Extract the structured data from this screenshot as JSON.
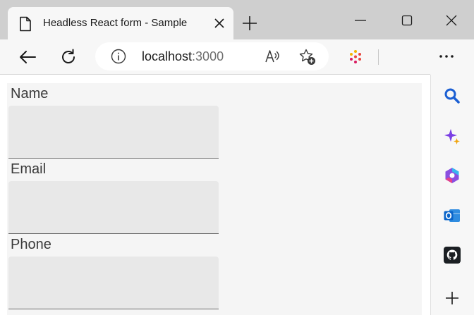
{
  "browser": {
    "tab": {
      "title": "Headless React form - Sample"
    },
    "address": {
      "host": "localhost",
      "port": ":3000"
    }
  },
  "form": {
    "fields": [
      {
        "label": "Name",
        "value": ""
      },
      {
        "label": "Email",
        "value": ""
      },
      {
        "label": "Phone",
        "value": ""
      }
    ]
  },
  "icons": {
    "tab": [
      "document-icon",
      "close-icon"
    ],
    "window": [
      "minimize-icon",
      "maximize-icon",
      "close-icon"
    ],
    "toolbar": [
      "back-arrow-icon",
      "reload-icon",
      "info-icon",
      "read-aloud-icon",
      "add-favorite-icon",
      "extension-icon",
      "more-icon"
    ],
    "sidebar": [
      "search-icon",
      "copilot-icon",
      "microsoft-365-icon",
      "outlook-icon",
      "github-icon",
      "add-icon"
    ]
  },
  "colors": {
    "frame": "#cfcfcf",
    "toolbar": "#f7f7f7",
    "input_fill": "#e8e8e8",
    "search_blue": "#1b5fd3",
    "outlook_blue": "#0a64c9"
  }
}
